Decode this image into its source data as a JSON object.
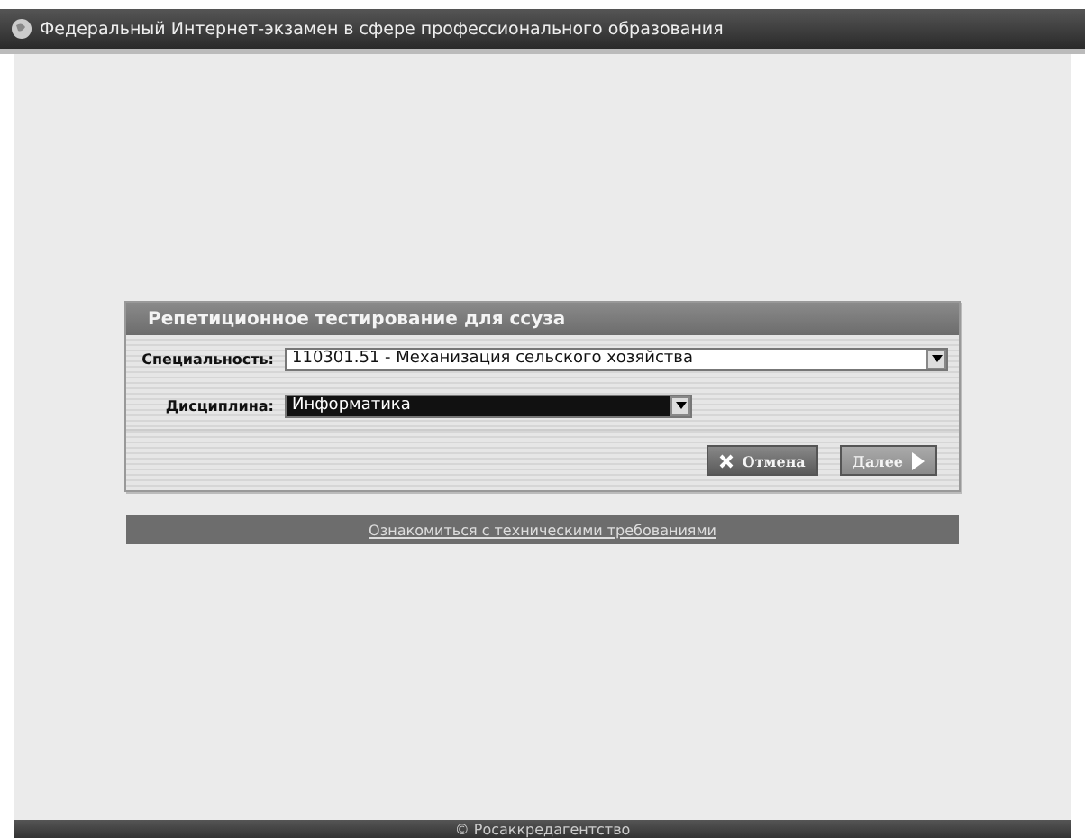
{
  "window": {
    "title": "Федеральный Интернет-экзамен в сфере профессионального образования"
  },
  "dialog": {
    "title": "Репетиционное тестирование для ссуза",
    "fields": [
      {
        "label": "Специальность:",
        "value": "110301.51 - Механизация сельского хозяйства",
        "focused": false
      },
      {
        "label": "Дисциплина:",
        "value": "Информатика",
        "focused": true
      }
    ],
    "buttons": [
      {
        "label": "Отмена",
        "kind": "cancel"
      },
      {
        "label": "Далее",
        "kind": "next"
      }
    ]
  },
  "link": "Ознакомиться с техническими требованиями",
  "footer": "© Росаккредагентство"
}
